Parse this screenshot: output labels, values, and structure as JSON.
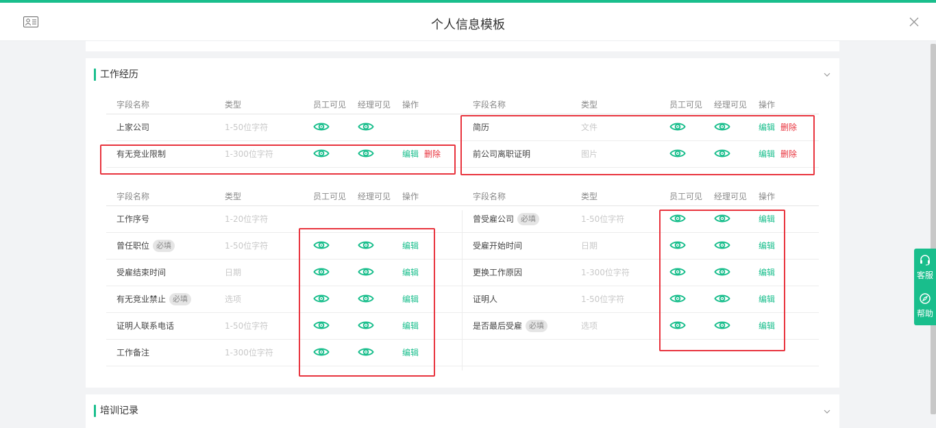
{
  "window": {
    "title": "个人信息模板"
  },
  "colors": {
    "accent": "#19be8c",
    "danger": "#e8323c",
    "highlight_box": "#e8323c"
  },
  "sections": [
    {
      "title": "工作经历"
    },
    {
      "title": "培训记录"
    }
  ],
  "table_headers": {
    "name": "字段名称",
    "type": "类型",
    "employee_visible": "员工可见",
    "manager_visible": "经理可见",
    "action": "操作"
  },
  "actions": {
    "edit": "编辑",
    "delete": "删除"
  },
  "required_badge": "必填",
  "custom_left": [
    {
      "name": "上家公司",
      "type": "1-50位字符",
      "employee_visible": true,
      "manager_visible": true,
      "edit": false,
      "delete": false
    },
    {
      "name": "有无竞业限制",
      "type": "1-300位字符",
      "employee_visible": true,
      "manager_visible": true,
      "edit": true,
      "delete": true
    }
  ],
  "custom_right": [
    {
      "name": "简历",
      "type": "文件",
      "employee_visible": true,
      "manager_visible": true,
      "edit": true,
      "delete": true
    },
    {
      "name": "前公司离职证明",
      "type": "图片",
      "employee_visible": true,
      "manager_visible": true,
      "edit": true,
      "delete": true
    }
  ],
  "system_left": [
    {
      "name": "工作序号",
      "type": "1-20位字符",
      "required": false,
      "employee_visible": false,
      "manager_visible": false,
      "edit": false
    },
    {
      "name": "曾任职位",
      "type": "1-50位字符",
      "required": true,
      "employee_visible": true,
      "manager_visible": true,
      "edit": true
    },
    {
      "name": "受雇结束时间",
      "type": "日期",
      "required": false,
      "employee_visible": true,
      "manager_visible": true,
      "edit": true
    },
    {
      "name": "有无竞业禁止",
      "type": "选项",
      "required": true,
      "employee_visible": true,
      "manager_visible": true,
      "edit": true
    },
    {
      "name": "证明人联系电话",
      "type": "1-50位字符",
      "required": false,
      "employee_visible": true,
      "manager_visible": true,
      "edit": true
    },
    {
      "name": "工作备注",
      "type": "1-300位字符",
      "required": false,
      "employee_visible": true,
      "manager_visible": true,
      "edit": true
    }
  ],
  "system_right": [
    {
      "name": "曾受雇公司",
      "type": "1-50位字符",
      "required": true,
      "employee_visible": true,
      "manager_visible": true,
      "edit": true
    },
    {
      "name": "受雇开始时间",
      "type": "日期",
      "required": false,
      "employee_visible": true,
      "manager_visible": true,
      "edit": true
    },
    {
      "name": "更换工作原因",
      "type": "1-300位字符",
      "required": false,
      "employee_visible": true,
      "manager_visible": true,
      "edit": true
    },
    {
      "name": "证明人",
      "type": "1-50位字符",
      "required": false,
      "employee_visible": true,
      "manager_visible": true,
      "edit": true
    },
    {
      "name": "是否最后受雇",
      "type": "选项",
      "required": true,
      "employee_visible": true,
      "manager_visible": true,
      "edit": true
    }
  ],
  "side_tools": [
    {
      "label": "客服",
      "icon": "headset-icon"
    },
    {
      "label": "帮助",
      "icon": "compass-icon"
    }
  ]
}
